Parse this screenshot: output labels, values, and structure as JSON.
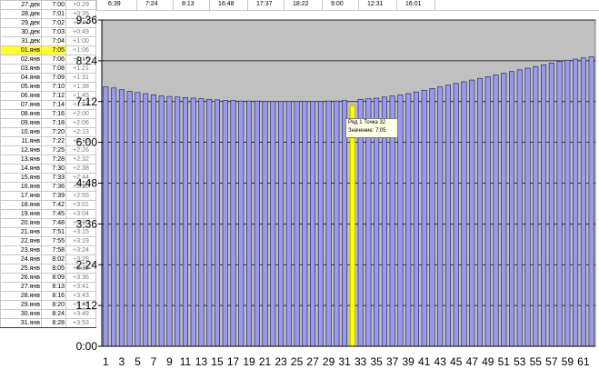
{
  "sheet": {
    "top_times": [
      "6:39",
      "7:24",
      "8:13",
      "16:48",
      "17:37",
      "18:22",
      "9:00",
      "12:31",
      "16:01"
    ],
    "rows": [
      {
        "date": "27.дек",
        "time": "7:00",
        "delta": "+0:29"
      },
      {
        "date": "28.дек",
        "time": "7:01",
        "delta": "+0:35"
      },
      {
        "date": "29.дек",
        "time": "7:02",
        "delta": "+0:44"
      },
      {
        "date": "30.дек",
        "time": "7:03",
        "delta": "+0:49"
      },
      {
        "date": "31.дек",
        "time": "7:04",
        "delta": "+1:00"
      },
      {
        "date": "01.янв",
        "time": "7:05",
        "delta": "+1:06"
      },
      {
        "date": "02.янв",
        "time": "7:06",
        "delta": "+1:16"
      },
      {
        "date": "03.янв",
        "time": "7:08",
        "delta": "+1:21"
      },
      {
        "date": "04.янв",
        "time": "7:09",
        "delta": "+1:31"
      },
      {
        "date": "05.янв",
        "time": "7:10",
        "delta": "+1:38"
      },
      {
        "date": "06.янв",
        "time": "7:12",
        "delta": "+1:45"
      },
      {
        "date": "07.янв",
        "time": "7:14",
        "delta": "+1:54"
      },
      {
        "date": "08.янв",
        "time": "7:16",
        "delta": "+2:00"
      },
      {
        "date": "09.янв",
        "time": "7:18",
        "delta": "+2:06"
      },
      {
        "date": "10.янв",
        "time": "7:20",
        "delta": "+2:13"
      },
      {
        "date": "11.янв",
        "time": "7:22",
        "delta": "+2:20"
      },
      {
        "date": "12.янв",
        "time": "7:25",
        "delta": "+2:26"
      },
      {
        "date": "13.янв",
        "time": "7:28",
        "delta": "+2:32"
      },
      {
        "date": "14.янв",
        "time": "7:30",
        "delta": "+2:38"
      },
      {
        "date": "15.янв",
        "time": "7:33",
        "delta": "+2:44"
      },
      {
        "date": "16.янв",
        "time": "7:36",
        "delta": "+2:50"
      },
      {
        "date": "17.янв",
        "time": "7:39",
        "delta": "+2:55"
      },
      {
        "date": "18.янв",
        "time": "7:42",
        "delta": "+3:01"
      },
      {
        "date": "19.янв",
        "time": "7:45",
        "delta": "+3:04"
      },
      {
        "date": "20.янв",
        "time": "7:48",
        "delta": "+3:10"
      },
      {
        "date": "21.янв",
        "time": "7:51",
        "delta": "+3:15"
      },
      {
        "date": "22.янв",
        "time": "7:55",
        "delta": "+3:19"
      },
      {
        "date": "23.янв",
        "time": "7:58",
        "delta": "+3:24"
      },
      {
        "date": "24.янв",
        "time": "8:02",
        "delta": "+3:28"
      },
      {
        "date": "25.янв",
        "time": "8:05",
        "delta": "+3:32"
      },
      {
        "date": "26.янв",
        "time": "8:09",
        "delta": "+3:36"
      },
      {
        "date": "27.янв",
        "time": "8:13",
        "delta": "+3:41"
      },
      {
        "date": "28.янв",
        "time": "8:16",
        "delta": "+3:43"
      },
      {
        "date": "29.янв",
        "time": "8:20",
        "delta": "+3:46"
      },
      {
        "date": "30.янв",
        "time": "8:24",
        "delta": "+3:49"
      },
      {
        "date": "31.янв",
        "time": "8:28",
        "delta": "+3:53"
      }
    ]
  },
  "chart_data": {
    "type": "bar",
    "title": "",
    "xlabel": "",
    "ylabel": "",
    "yticks": [
      "0:00",
      "1:12",
      "2:24",
      "3:36",
      "4:48",
      "6:00",
      "7:12",
      "8:24",
      "9:36"
    ],
    "ylim_minutes": [
      0,
      576
    ],
    "grid": "horizontal",
    "highlighted_point": 32,
    "colors": {
      "bar": "#9999ee",
      "bar_edge": "#1a1a4a",
      "highlight": "#ffff00",
      "plot_bg": "#c0c0c0"
    },
    "x": [
      1,
      2,
      3,
      4,
      5,
      6,
      7,
      8,
      9,
      10,
      11,
      12,
      13,
      14,
      15,
      16,
      17,
      18,
      19,
      20,
      21,
      22,
      23,
      24,
      25,
      26,
      27,
      28,
      29,
      30,
      31,
      32,
      33,
      34,
      35,
      36,
      37,
      38,
      39,
      40,
      41,
      42,
      43,
      44,
      45,
      46,
      47,
      48,
      49,
      50,
      51,
      52,
      53,
      54,
      55,
      56,
      57,
      58,
      59,
      60,
      61,
      62
    ],
    "x_tick_labels": [
      "1",
      "3",
      "5",
      "7",
      "9",
      "11",
      "13",
      "15",
      "17",
      "19",
      "21",
      "23",
      "25",
      "27",
      "29",
      "31",
      "33",
      "35",
      "37",
      "39",
      "41",
      "43",
      "45",
      "47",
      "49",
      "51",
      "53",
      "55",
      "57",
      "59",
      "61"
    ],
    "values_minutes": [
      458,
      456,
      453,
      450,
      448,
      446,
      444,
      442,
      441,
      440,
      439,
      438,
      437,
      436,
      435,
      434,
      434,
      433,
      433,
      433,
      432,
      432,
      432,
      432,
      432,
      432,
      432,
      432,
      433,
      433,
      434,
      425,
      436,
      437,
      438,
      440,
      442,
      444,
      446,
      449,
      452,
      455,
      458,
      461,
      464,
      467,
      470,
      473,
      476,
      479,
      482,
      485,
      488,
      491,
      494,
      497,
      500,
      503,
      505,
      507,
      509,
      511
    ],
    "tooltip": {
      "line1": "Ряд 1 Точка 32",
      "line2": "Значение: 7:05"
    }
  }
}
